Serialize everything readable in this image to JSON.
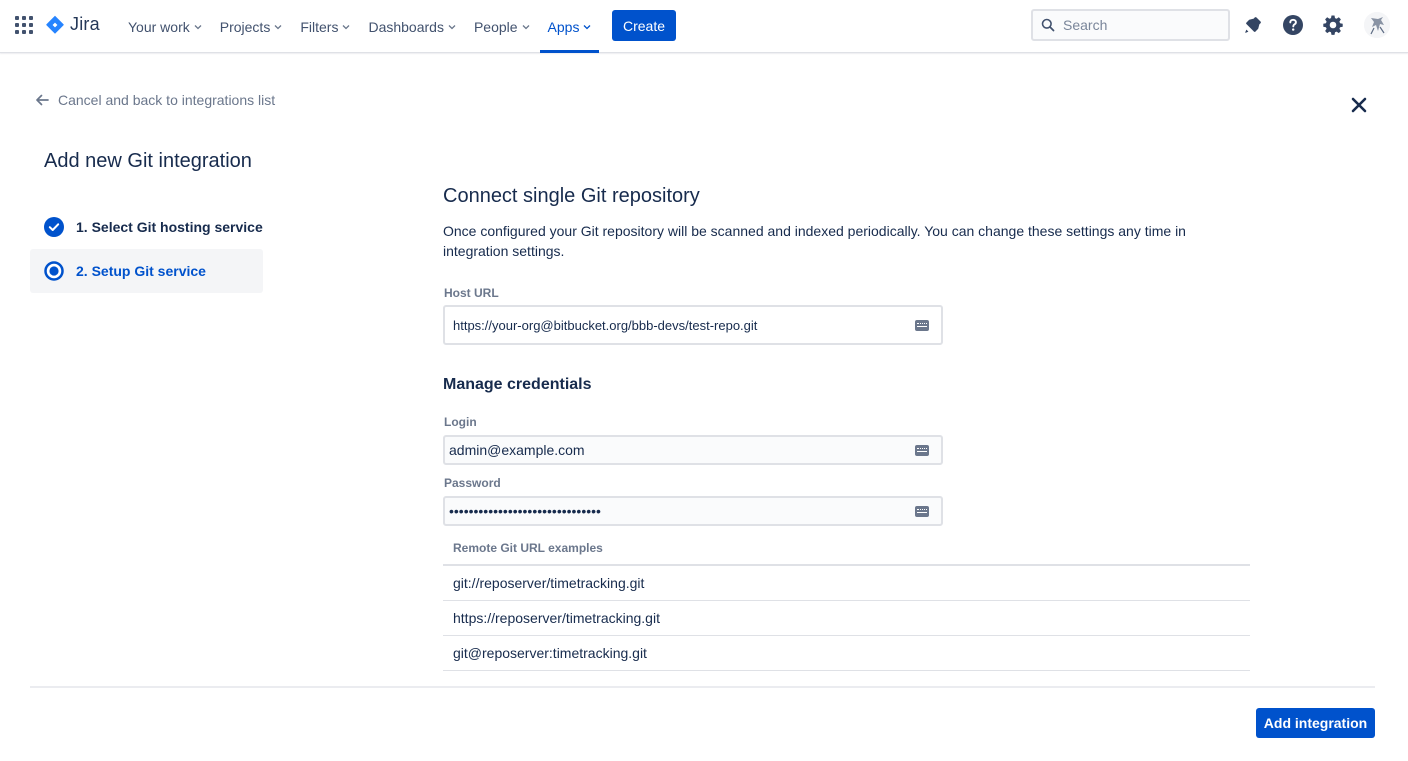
{
  "topnav": {
    "product_name": "Jira",
    "items": [
      {
        "label": "Your work",
        "active": false
      },
      {
        "label": "Projects",
        "active": false
      },
      {
        "label": "Filters",
        "active": false
      },
      {
        "label": "Dashboards",
        "active": false
      },
      {
        "label": "People",
        "active": false
      },
      {
        "label": "Apps",
        "active": true
      }
    ],
    "create_label": "Create",
    "search_placeholder": "Search",
    "icons": [
      "app-switcher-icon",
      "notifications-icon",
      "help-icon",
      "settings-icon"
    ]
  },
  "back_link": "Cancel and back to integrations list",
  "page_title": "Add new Git integration",
  "steps": [
    {
      "label": "1. Select Git hosting service",
      "state": "done"
    },
    {
      "label": "2. Setup Git service",
      "state": "current"
    }
  ],
  "form": {
    "heading": "Connect single Git repository",
    "description": "Once configured your Git repository will be scanned and indexed periodically. You can change these settings any time in integration settings.",
    "host_url_label": "Host URL",
    "host_url_value": "https://your-org@bitbucket.org/bbb-devs/test-repo.git",
    "credentials_heading": "Manage credentials",
    "login_label": "Login",
    "login_value": "admin@example.com",
    "password_label": "Password",
    "password_value": "secretpasswordvalue1234567890ab"
  },
  "examples": {
    "header": "Remote Git URL examples",
    "rows": [
      "git://reposerver/timetracking.git",
      "https://reposerver/timetracking.git",
      "git@reposerver:timetracking.git"
    ]
  },
  "footer": {
    "add_label": "Add integration"
  },
  "colors": {
    "primary": "#0052cc",
    "text": "#172b4d",
    "subtle": "#6b778c",
    "border": "#dfe1e6"
  }
}
